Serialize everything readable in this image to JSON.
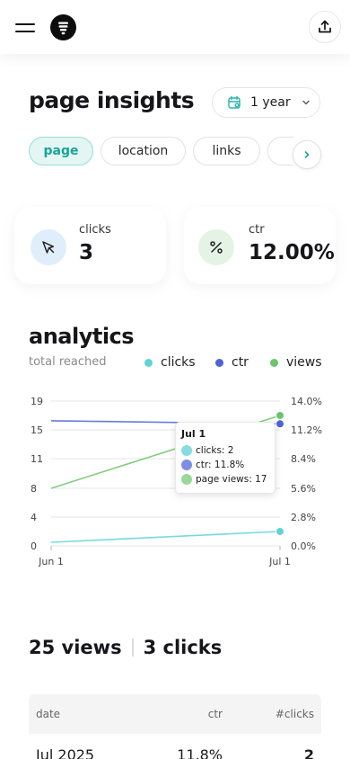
{
  "header": {
    "menu_icon": "hamburger-icon",
    "logo_icon": "brand-logo",
    "share_icon": "upload-icon"
  },
  "page": {
    "title": "page insights",
    "date_range": "1 year",
    "tabs": [
      {
        "label": "page",
        "active": true
      },
      {
        "label": "location",
        "active": false
      },
      {
        "label": "links",
        "active": false
      }
    ]
  },
  "stats": [
    {
      "label": "clicks",
      "value": "3",
      "icon": "cursor-arrow-icon",
      "color": "#e0edfb"
    },
    {
      "label": "ctr",
      "value": "12.00%",
      "icon": "percent-icon",
      "color": "#e4f3e5"
    }
  ],
  "analytics": {
    "title": "analytics",
    "subtitle": "total reached",
    "legend": [
      {
        "label": "clicks",
        "color": "#5fd3d6"
      },
      {
        "label": "ctr",
        "color": "#4f63d6"
      },
      {
        "label": "views",
        "color": "#6cc46c"
      }
    ],
    "tooltip": {
      "title": "Jul 1",
      "rows": [
        {
          "text": "clicks: 2",
          "color": "#86dcde"
        },
        {
          "text": "ctr: 11.8%",
          "color": "#7f8de4"
        },
        {
          "text": "page views: 17",
          "color": "#9ad89a"
        }
      ]
    }
  },
  "chart_data": {
    "type": "line",
    "x": [
      "Jun 1",
      "Jul 1"
    ],
    "left_axis": {
      "ticks": [
        "0",
        "4",
        "8",
        "11",
        "15",
        "19"
      ],
      "range": [
        0,
        19
      ]
    },
    "right_axis": {
      "ticks": [
        "0.0%",
        "2.8%",
        "5.6%",
        "8.4%",
        "11.2%",
        "14.0%"
      ],
      "range": [
        0,
        14
      ]
    },
    "series": [
      {
        "name": "clicks",
        "axis": "left",
        "values": [
          0.5,
          2
        ],
        "color": "#5fd3d6"
      },
      {
        "name": "ctr",
        "axis": "right",
        "values": [
          12.1,
          11.8
        ],
        "color": "#4f63d6"
      },
      {
        "name": "page views",
        "axis": "left",
        "values": [
          8,
          17
        ],
        "color": "#6cc46c"
      }
    ],
    "grid": true
  },
  "summary": {
    "views": "25 views",
    "clicks": "3 clicks"
  },
  "table": {
    "headers": [
      "date",
      "ctr",
      "#clicks"
    ],
    "rows": [
      [
        "Jul 2025",
        "11.8%",
        "2"
      ]
    ]
  }
}
